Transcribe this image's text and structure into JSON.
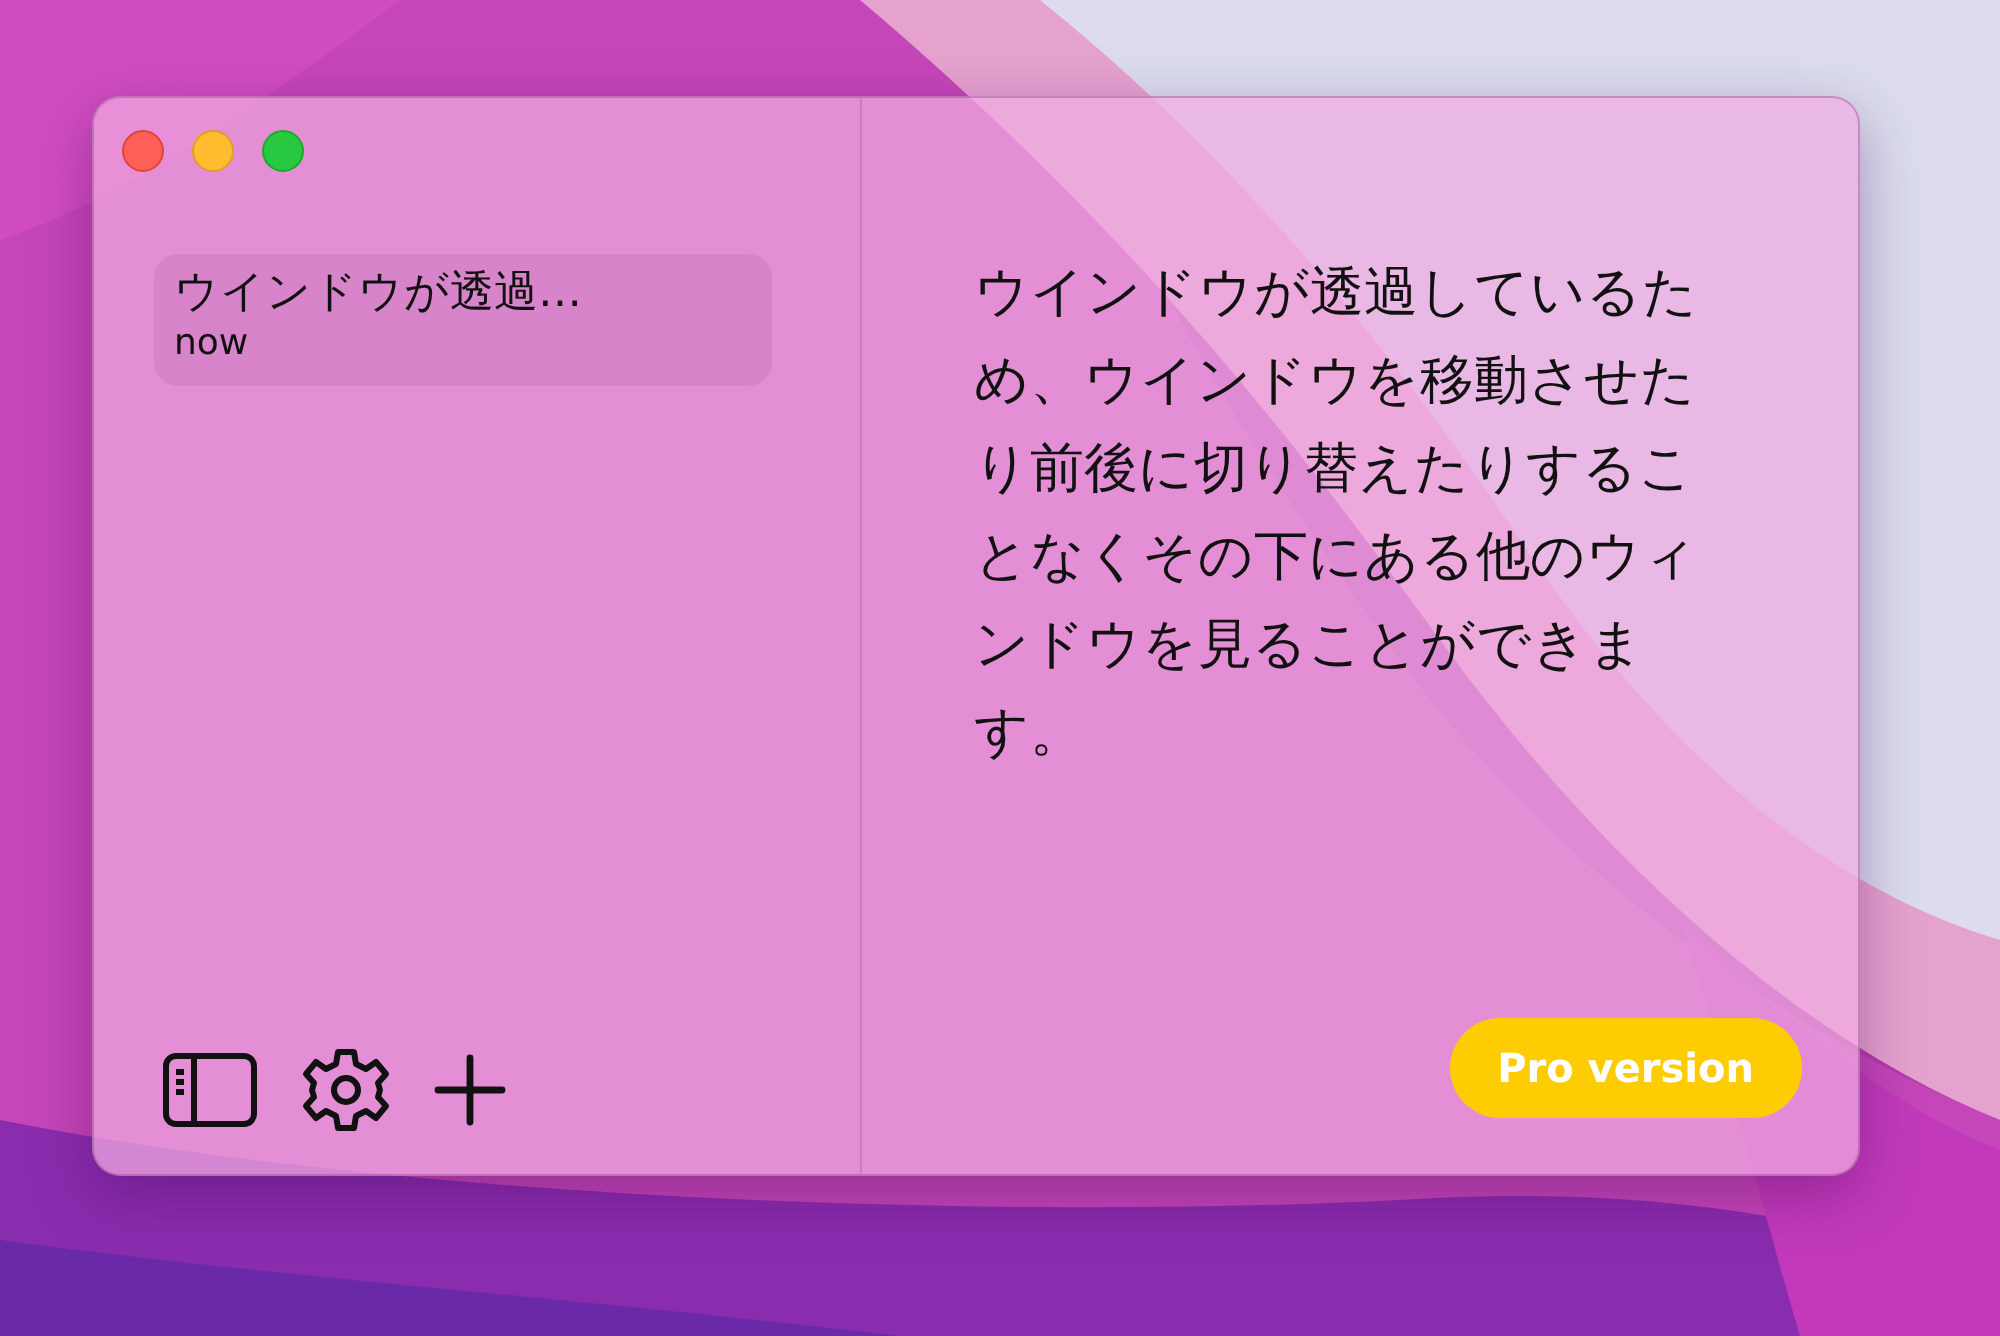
{
  "window": {
    "controls": [
      {
        "kind": "close"
      },
      {
        "kind": "minimize"
      },
      {
        "kind": "zoom"
      }
    ]
  },
  "sidebar": {
    "notes": [
      {
        "title": "ウインドウが透過…",
        "time": "now",
        "selected": true
      }
    ],
    "toolbar": [
      {
        "kind": "sidebar"
      },
      {
        "kind": "settings"
      },
      {
        "kind": "add"
      }
    ]
  },
  "note": {
    "text": "ウインドウが透過しているため、ウインドウを移動させたり前後に切り替えたりすることなくその下にある他のウィンドウを見ることができます。"
  },
  "pro_button": "Pro version"
}
